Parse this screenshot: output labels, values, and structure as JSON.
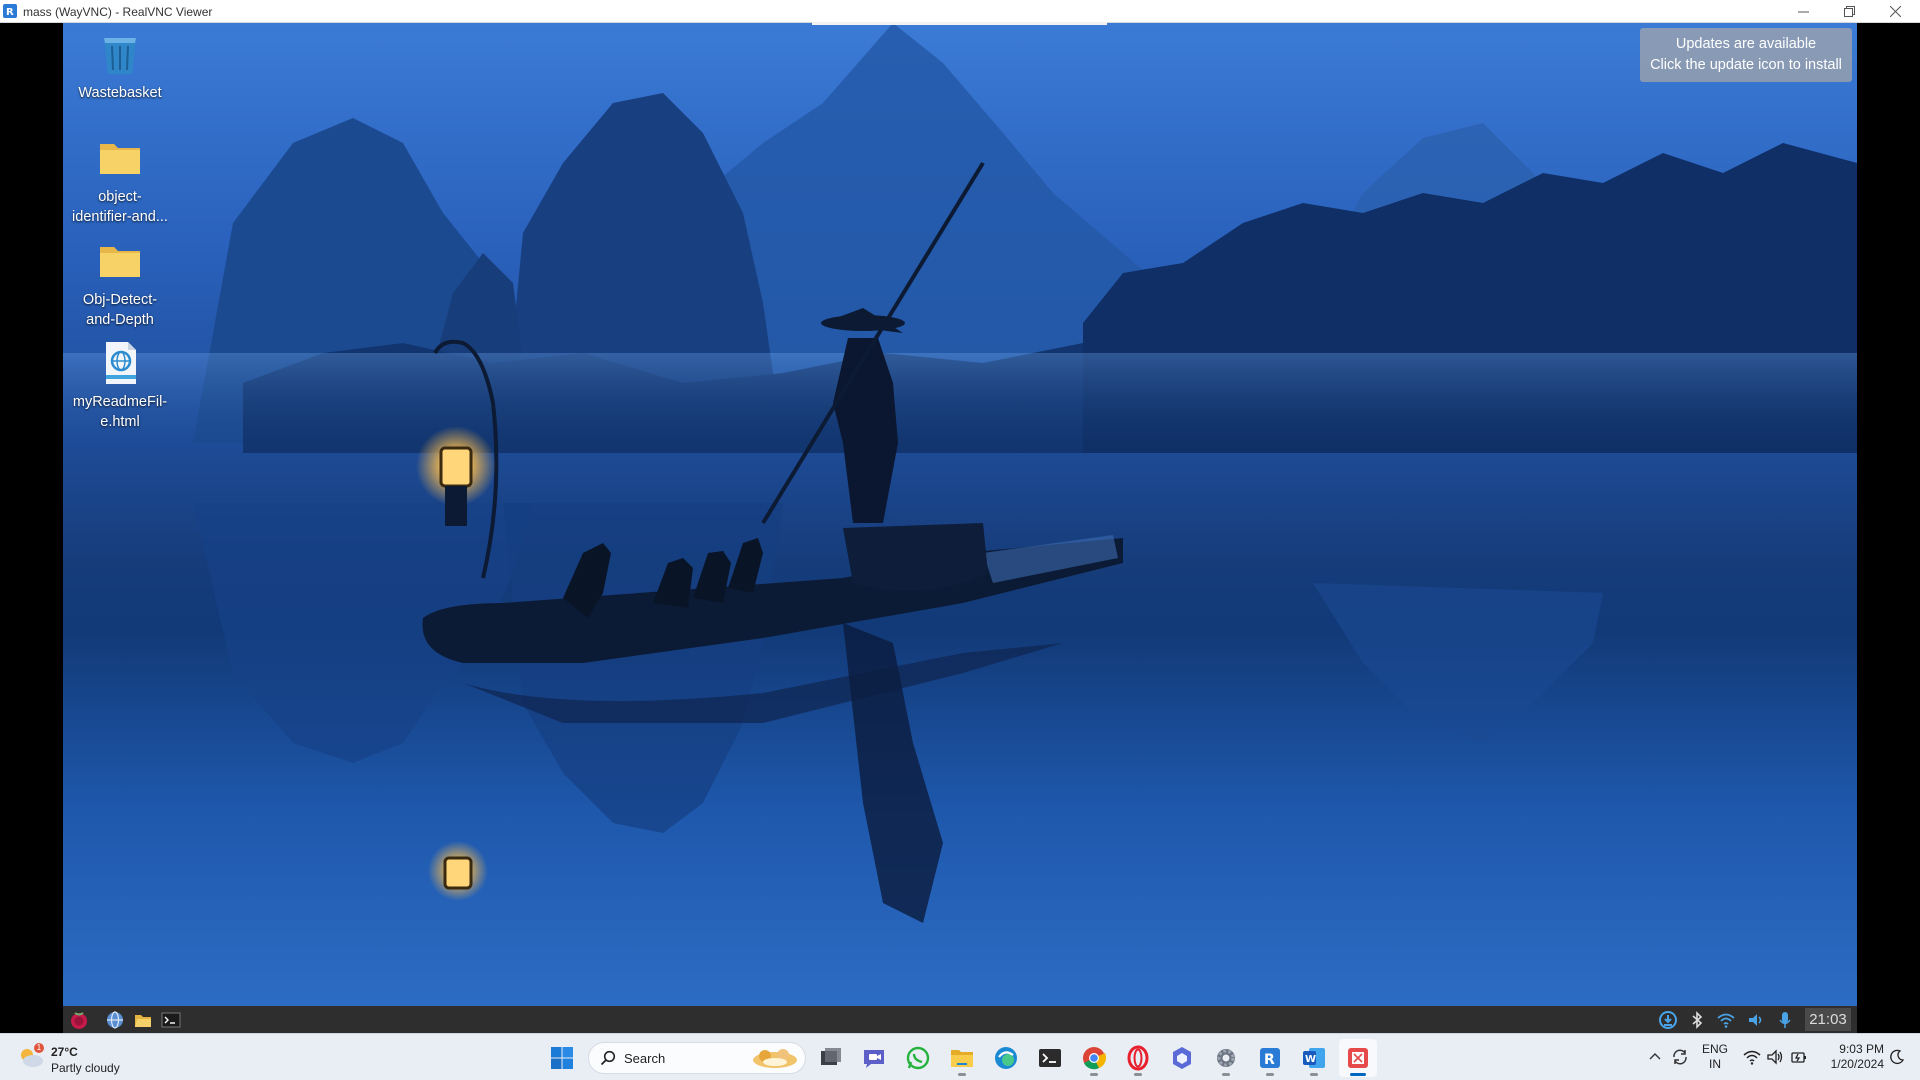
{
  "window": {
    "title": "mass (WayVNC) - RealVNC Viewer",
    "buttons": [
      "minimize",
      "restore",
      "close"
    ]
  },
  "desktop": {
    "icons": [
      {
        "label": "Wastebasket",
        "icon": "wastebasket-icon"
      },
      {
        "label": "object-\nidentifier-and...",
        "icon": "folder-icon"
      },
      {
        "label": "Obj-Detect-\nand-Depth",
        "icon": "folder-icon"
      },
      {
        "label": "myReadmeFil-\ne.html",
        "icon": "html-file-icon"
      }
    ],
    "notification": {
      "line1": "Updates are available",
      "line2": "Click the update icon to install"
    },
    "wallpaper": "fisherman-with-lantern-on-bamboo-raft"
  },
  "pi_panel": {
    "launchers": [
      "raspberry-menu-icon",
      "web-browser-icon",
      "file-manager-icon",
      "terminal-icon"
    ],
    "tray": [
      "updater-icon",
      "bluetooth-icon",
      "wifi-icon",
      "volume-icon",
      "microphone-icon"
    ],
    "clock": "21:03"
  },
  "taskbar": {
    "weather": {
      "temp": "27°C",
      "condition": "Partly cloudy",
      "badge": "1"
    },
    "search_placeholder": "Search",
    "apps": [
      "windows-start-icon",
      "task-view-icon",
      "teams-chat-icon",
      "whatsapp-icon",
      "file-explorer-icon",
      "edge-icon",
      "terminal-icon",
      "chrome-icon",
      "opera-icon",
      "copilot-icon",
      "settings-icon",
      "realvnc-icon",
      "word-icon",
      "snipping-tool-icon"
    ],
    "tray": {
      "language_line1": "ENG",
      "language_line2": "IN",
      "time": "9:03 PM",
      "date": "1/20/2024"
    }
  },
  "colors": {
    "accent": "#0067c0",
    "pi_panel": "#2e2e2e",
    "taskbar": "#e9edf4"
  }
}
